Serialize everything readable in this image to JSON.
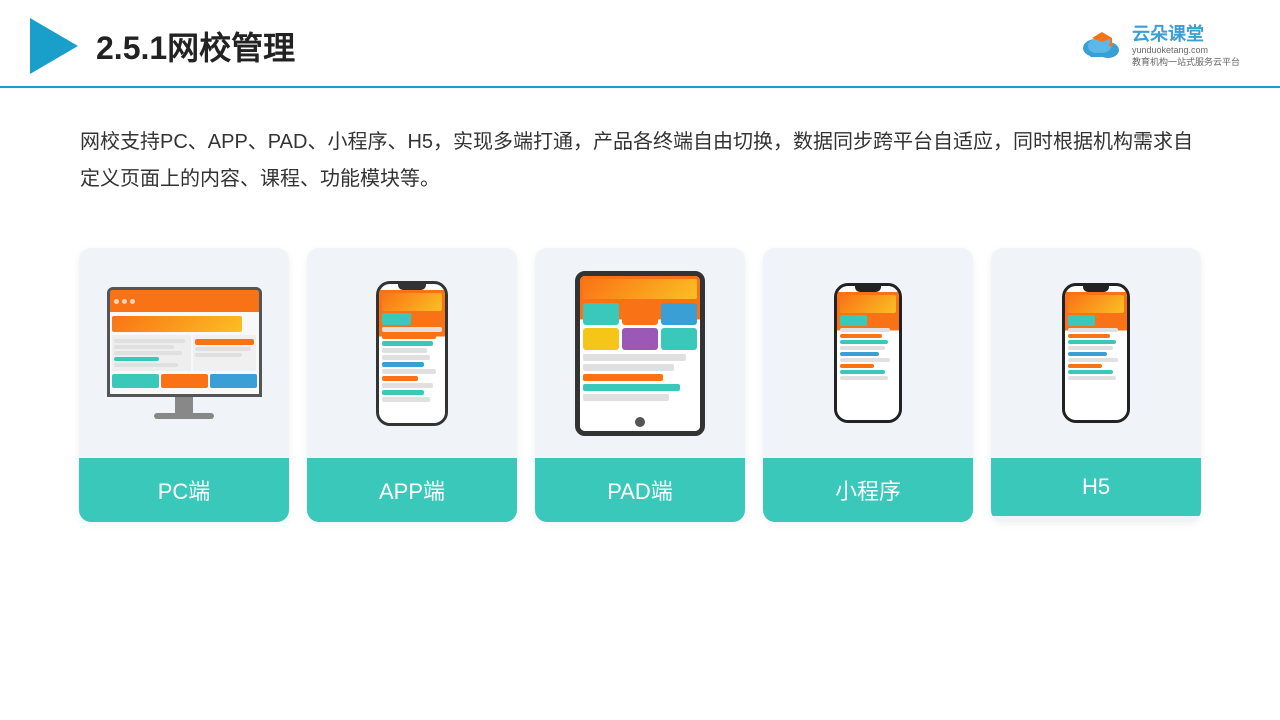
{
  "header": {
    "title": "2.5.1网校管理",
    "logo_brand": "云朵课堂",
    "logo_url": "yunduoketang.com",
    "logo_tagline1": "教育机构一站",
    "logo_tagline2": "式服务云平台"
  },
  "description": {
    "text": "网校支持PC、APP、PAD、小程序、H5，实现多端打通，产品各终端自由切换，数据同步跨平台自适应，同时根据机构需求自定义页面上的内容、课程、功能模块等。"
  },
  "cards": [
    {
      "id": "pc",
      "label": "PC端"
    },
    {
      "id": "app",
      "label": "APP端"
    },
    {
      "id": "pad",
      "label": "PAD端"
    },
    {
      "id": "miniprogram",
      "label": "小程序"
    },
    {
      "id": "h5",
      "label": "H5"
    }
  ],
  "colors": {
    "primary": "#1a9fcb",
    "teal": "#3ac8bb",
    "orange": "#f97316"
  }
}
